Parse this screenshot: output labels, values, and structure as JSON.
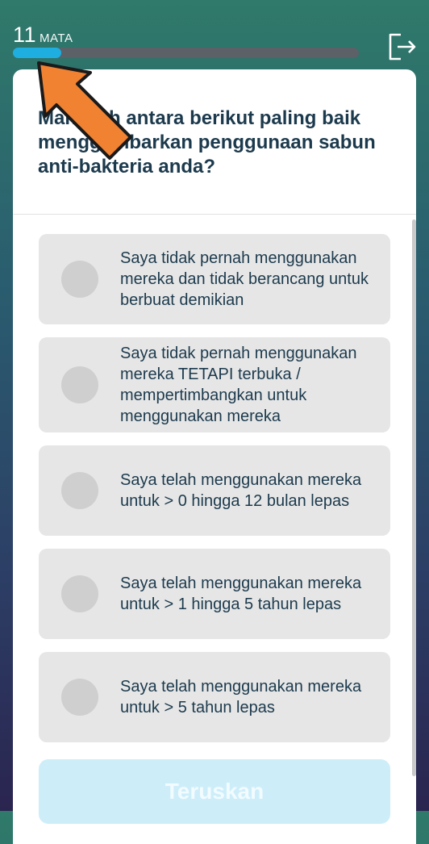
{
  "header": {
    "points_value": "11",
    "points_label": "MATA",
    "progress_fraction": 0.14
  },
  "question": {
    "text_part1": "Manakah antara berikut paling baik menggambarkan penggunaan ",
    "text_bold": "sabun anti-bakteria",
    "text_part2": " anda?"
  },
  "options": [
    {
      "label": "Saya tidak pernah menggunakan mereka dan tidak berancang untuk berbuat demikian"
    },
    {
      "label": "Saya tidak pernah menggunakan mereka TETAPI terbuka / mempertimbangkan untuk menggunakan mereka"
    },
    {
      "label": "Saya telah menggunakan mereka untuk > 0 hingga 12 bulan lepas"
    },
    {
      "label": "Saya telah menggunakan mereka untuk > 1 hingga 5 tahun lepas"
    },
    {
      "label": "Saya telah menggunakan mereka untuk > 5 tahun lepas"
    }
  ],
  "continue_label": "Teruskan",
  "colors": {
    "accent": "#1eaee0",
    "text": "#1c3a4d",
    "option_bg": "#e6e6e6",
    "arrow": "#f08232"
  },
  "icons": {
    "exit": "exit-icon"
  }
}
